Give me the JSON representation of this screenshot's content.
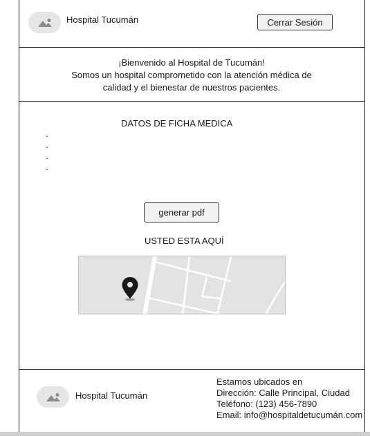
{
  "header": {
    "brand_name": "Hospital Tucumán",
    "logout_label": "Cerrar Sesión"
  },
  "welcome": {
    "line1": "¡Bienvenido al Hospital de Tucumán!",
    "line2": "Somos un hospital comprometido con la atención médica de",
    "line3": "calidad y el bienestar de nuestros pacientes."
  },
  "main": {
    "ficha_title": "DATOS DE FICHA MEDICA",
    "ficha_items": [
      ".",
      ".",
      ".",
      "."
    ],
    "generate_pdf_label": "generar pdf",
    "location_label": "USTED ESTA AQUÍ"
  },
  "footer": {
    "brand_name": "Hospital Tucumán",
    "info_heading": "Estamos ubicados en",
    "address": "Dirección: Calle Principal, Ciudad",
    "phone": "Teléfono: (123) 456-7890",
    "email": "Email: info@hospitaldetucumán.com"
  },
  "icons": {
    "logo": "image-placeholder-icon",
    "map_marker": "map-pin-icon"
  },
  "colors": {
    "placeholder_bg": "#e6e6e6",
    "placeholder_icon": "#8c8c8c",
    "map_bg": "#e3e3e3",
    "pin": "#1a1a1a"
  }
}
